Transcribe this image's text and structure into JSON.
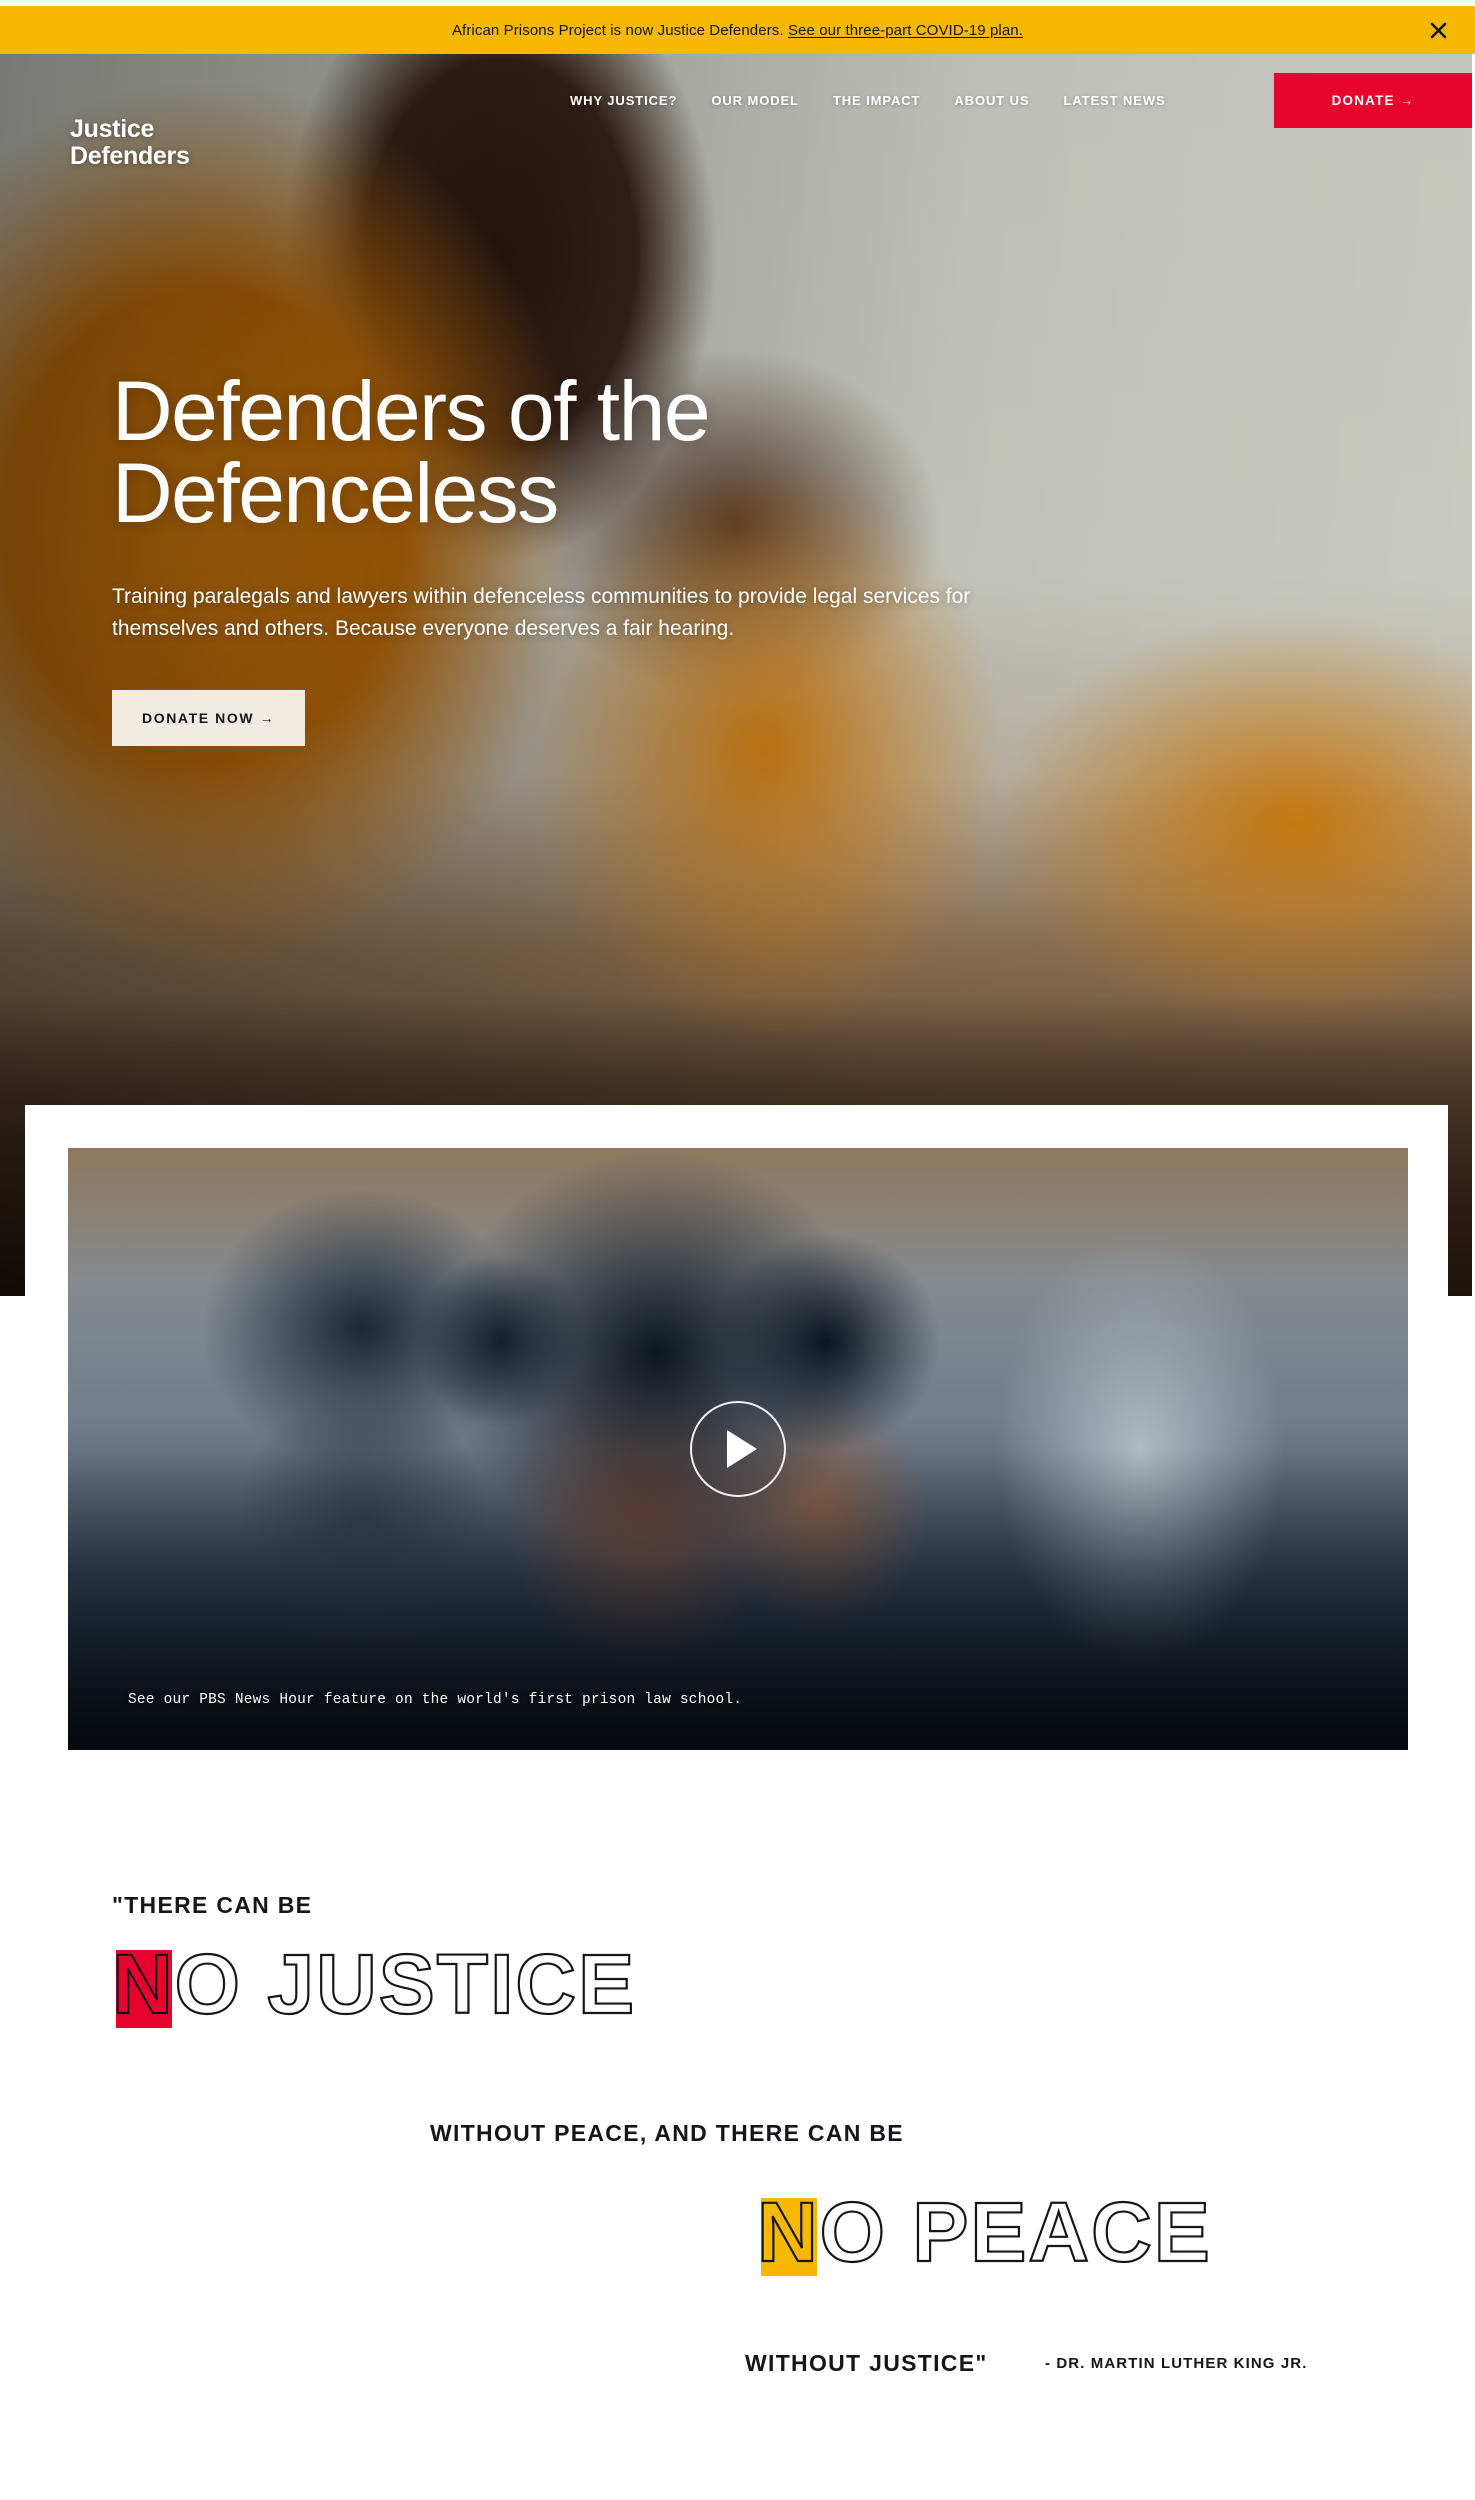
{
  "announcement": {
    "text_before": "African Prisons Project is now Justice Defenders.",
    "link_text": "See our three-part COVID-19 plan.",
    "close_icon": "close-icon",
    "background_color": "#f6b800"
  },
  "nav": {
    "brand_line1": "Justice",
    "brand_line2": "Defenders",
    "links": [
      {
        "label": "WHY JUSTICE?"
      },
      {
        "label": "OUR MODEL"
      },
      {
        "label": "THE IMPACT"
      },
      {
        "label": "ABOUT US"
      },
      {
        "label": "LATEST NEWS"
      }
    ],
    "donate_label": "DONATE →",
    "donate_color": "#e8022e"
  },
  "hero": {
    "title_line1": "Defenders of the",
    "title_line2": "Defenceless",
    "subtitle": "Training paralegals and lawyers within defenceless communities to provide legal services for themselves and others. Because everyone deserves a fair hearing.",
    "cta_label": "DONATE NOW →"
  },
  "video": {
    "play_icon": "play-icon",
    "caption": "See our PBS News Hour feature on the world's first prison law school."
  },
  "quote": {
    "line1": "\"THERE CAN BE",
    "line2_highlight": "N",
    "line2_rest": "O JUSTICE",
    "line2_highlight_color": "#e8022e",
    "line3": "WITHOUT PEACE, AND THERE CAN BE",
    "line4_highlight": "N",
    "line4_rest": "O PEACE",
    "line4_highlight_color": "#f6b800",
    "line5": "WITHOUT JUSTICE\"",
    "attribution": "- DR. MARTIN LUTHER KING JR."
  }
}
